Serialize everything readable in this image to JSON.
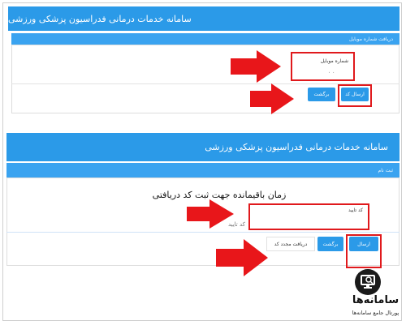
{
  "panel1": {
    "title": "سامانه خدمات درمانی فدراسیون پزشکی ورزشی",
    "subtitle": "دریافت شماره موبایل",
    "mobile_label": "شماره موبایل",
    "mobile_value": "۰ ۰",
    "send_button": "ارسال کد",
    "back_button": "برگشت"
  },
  "panel2": {
    "title": "سامانه خدمات درمانی فدراسیون پزشکی ورزشی",
    "subtitle": "ثبت نام",
    "timer_text": "زمان باقیمانده جهت ثبت کد دریافتی",
    "code_label": "کد تایید",
    "code_placeholder": "کد تایید",
    "register_button": "ارسال",
    "back_button": "برگشت",
    "resend_button": "دریافت مجدد کد"
  },
  "watermark": {
    "name": "سامانه‌ها",
    "tagline": "پورتال جامع سامانه‌ها"
  },
  "colors": {
    "primary": "#2b9ae8",
    "highlight": "#e0191c"
  },
  "icons": {
    "arrow": "red-arrow-icon",
    "logo": "monitor-magnifier-icon"
  }
}
